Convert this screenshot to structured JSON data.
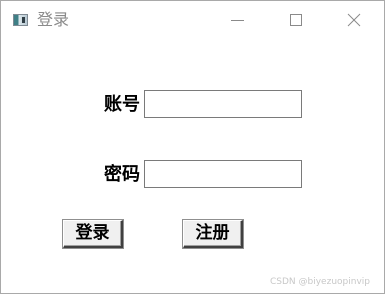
{
  "window": {
    "title": "登录",
    "icon": "app-window-icon"
  },
  "titlebar": {
    "minimize_icon": "minimize-icon",
    "maximize_icon": "maximize-icon",
    "close_icon": "close-icon"
  },
  "form": {
    "account_label": "账号",
    "account_value": "",
    "password_label": "密码",
    "password_value": ""
  },
  "buttons": {
    "login_label": "登录",
    "register_label": "注册"
  },
  "watermark": "CSDN @biyezuopinvip",
  "colors": {
    "title_text": "#8a8a8a",
    "button_face": "#f0f0f0",
    "border": "#7a7a7a"
  }
}
